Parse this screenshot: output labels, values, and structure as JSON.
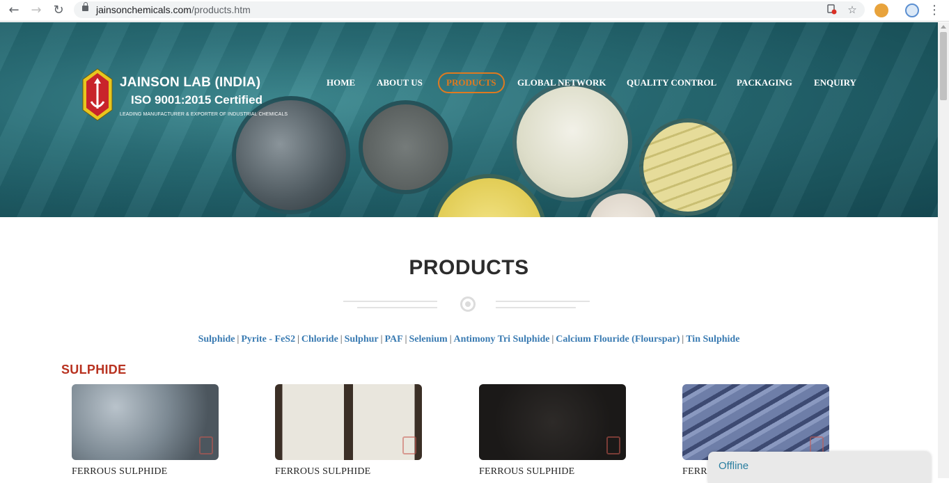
{
  "browser": {
    "url_domain": "jainsonchemicals.com",
    "url_path": "/products.htm"
  },
  "header": {
    "logo_title": "JAINSON LAB (INDIA)",
    "logo_iso": "ISO 9001:2015 Certified",
    "logo_tagline": "LEADING MANUFACTURER & EXPORTER OF INDUSTRIAL CHEMICALS",
    "menu": [
      {
        "label": "HOME"
      },
      {
        "label": "ABOUT US"
      },
      {
        "label": "PRODUCTS",
        "active": true
      },
      {
        "label": "GLOBAL NETWORK"
      },
      {
        "label": "QUALITY CONTROL"
      },
      {
        "label": "PACKAGING"
      },
      {
        "label": "ENQUIRY"
      }
    ]
  },
  "main": {
    "title": "PRODUCTS",
    "categories": [
      "Sulphide",
      "Pyrite - FeS2",
      "Chloride",
      "Sulphur",
      "PAF",
      "Selenium",
      "Antimony Tri Sulphide",
      "Calcium Flouride (Flourspar)",
      "Tin Sulphide"
    ],
    "section": {
      "heading": "SULPHIDE",
      "products": [
        {
          "name": "FERROUS SULPHIDE"
        },
        {
          "name": "FERROUS SULPHIDE"
        },
        {
          "name": "FERROUS SULPHIDE"
        },
        {
          "name": "FERR"
        }
      ]
    }
  },
  "chat": {
    "status": "Offline"
  },
  "colors": {
    "accent_orange": "#e07a1f",
    "section_red": "#b83220",
    "link_blue": "#3a7bb2"
  }
}
